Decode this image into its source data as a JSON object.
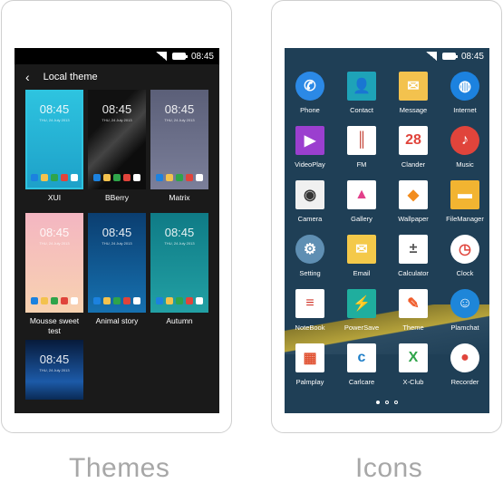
{
  "status": {
    "time": "08:45"
  },
  "themes_screen": {
    "title": "Local theme",
    "themes": [
      {
        "label": "XUI",
        "clock": "08:45",
        "date": "THU, 24 July 2013",
        "bg": "linear-gradient(#2ec4e0,#1da0c8)",
        "selected": true
      },
      {
        "label": "BBerry",
        "clock": "08:45",
        "date": "THU, 24 July 2013",
        "bg": "linear-gradient(135deg,#111 30%,#444 50%,#0d0d0d 70%)"
      },
      {
        "label": "Matrix",
        "clock": "08:45",
        "date": "THU, 24 July 2013",
        "bg": "linear-gradient(#5b5f78,#7b7f9a)"
      },
      {
        "label": "Mousse sweet test",
        "clock": "08:45",
        "date": "THU, 24 July 2013",
        "bg": "linear-gradient(#f4b6c2,#f8d2b0)"
      },
      {
        "label": "Animal story",
        "clock": "08:45",
        "date": "THU, 24 July 2013",
        "bg": "linear-gradient(#0b3e70,#1671b0)"
      },
      {
        "label": "Autumn",
        "clock": "08:45",
        "date": "THU, 24 July 2013",
        "bg": "linear-gradient(#0f7b86,#22a0a4)"
      },
      {
        "label": "",
        "clock": "08:45",
        "date": "THU, 24 July 2013",
        "bg": "linear-gradient(#071a3a,#1c5aa8 70%,#0a2a55)"
      }
    ]
  },
  "icons_screen": {
    "apps": [
      {
        "label": "Phone",
        "glyph": "✆",
        "color": "#2b89e6",
        "shape": "round"
      },
      {
        "label": "Contact",
        "glyph": "👤",
        "color": "#1ea3b8",
        "shape": "sq"
      },
      {
        "label": "Message",
        "glyph": "✉",
        "color": "#f3c24e",
        "shape": "sq"
      },
      {
        "label": "Internet",
        "glyph": "◍",
        "color": "#1c82df",
        "shape": "round"
      },
      {
        "label": "VideoPlay",
        "glyph": "▶",
        "color": "#9b3fcf",
        "shape": "sq"
      },
      {
        "label": "FM",
        "glyph": "║",
        "color": "#ffffff",
        "shape": "sq"
      },
      {
        "label": "Clander",
        "glyph": "28",
        "color": "#ffffff",
        "shape": "sq"
      },
      {
        "label": "Music",
        "glyph": "♪",
        "color": "#e0443b",
        "shape": "round"
      },
      {
        "label": "Camera",
        "glyph": "◉",
        "color": "#f0f0f0",
        "shape": "sq"
      },
      {
        "label": "Gallery",
        "glyph": "▲",
        "color": "#ffffff",
        "shape": "sq"
      },
      {
        "label": "Wallpaper",
        "glyph": "◆",
        "color": "#ffffff",
        "shape": "sq"
      },
      {
        "label": "FileManager",
        "glyph": "▬",
        "color": "#f2b431",
        "shape": "sq"
      },
      {
        "label": "Setting",
        "glyph": "⚙",
        "color": "#5f8fb3",
        "shape": "round"
      },
      {
        "label": "Email",
        "glyph": "✉",
        "color": "#f4c94a",
        "shape": "sq"
      },
      {
        "label": "Calculator",
        "glyph": "±",
        "color": "#ffffff",
        "shape": "sq"
      },
      {
        "label": "Clock",
        "glyph": "◷",
        "color": "#ffffff",
        "shape": "round"
      },
      {
        "label": "NoteBook",
        "glyph": "≡",
        "color": "#ffffff",
        "shape": "sq"
      },
      {
        "label": "PowerSave",
        "glyph": "⚡",
        "color": "#1fae9e",
        "shape": "sq"
      },
      {
        "label": "Theme",
        "glyph": "✎",
        "color": "#ffffff",
        "shape": "sq"
      },
      {
        "label": "Plamchat",
        "glyph": "☺",
        "color": "#1e86d9",
        "shape": "round"
      },
      {
        "label": "Palmplay",
        "glyph": "▦",
        "color": "#ffffff",
        "shape": "sq"
      },
      {
        "label": "Carlcare",
        "glyph": "c",
        "color": "#ffffff",
        "shape": "sq"
      },
      {
        "label": "X-Club",
        "glyph": "X",
        "color": "#ffffff",
        "shape": "sq"
      },
      {
        "label": "Recorder",
        "glyph": "●",
        "color": "#ffffff",
        "shape": "round"
      }
    ],
    "glyph_colors": [
      "#ffffff",
      "#ffffff",
      "#ffffff",
      "#ffffff",
      "#ffffff",
      "#c0392b",
      "#e0443b",
      "#ffffff",
      "#333333",
      "#e23f8a",
      "#f28c1d",
      "#ffffff",
      "#ffffff",
      "#ffffff",
      "#555555",
      "#e0443b",
      "#d23b2f",
      "#ffffff",
      "#f05a28",
      "#ffffff",
      "#e05030",
      "#1f7fc8",
      "#2fa44a",
      "#e0443b"
    ],
    "page_indicator": [
      true,
      false,
      false
    ]
  },
  "captions": {
    "left": "Themes",
    "right": "Icons"
  }
}
